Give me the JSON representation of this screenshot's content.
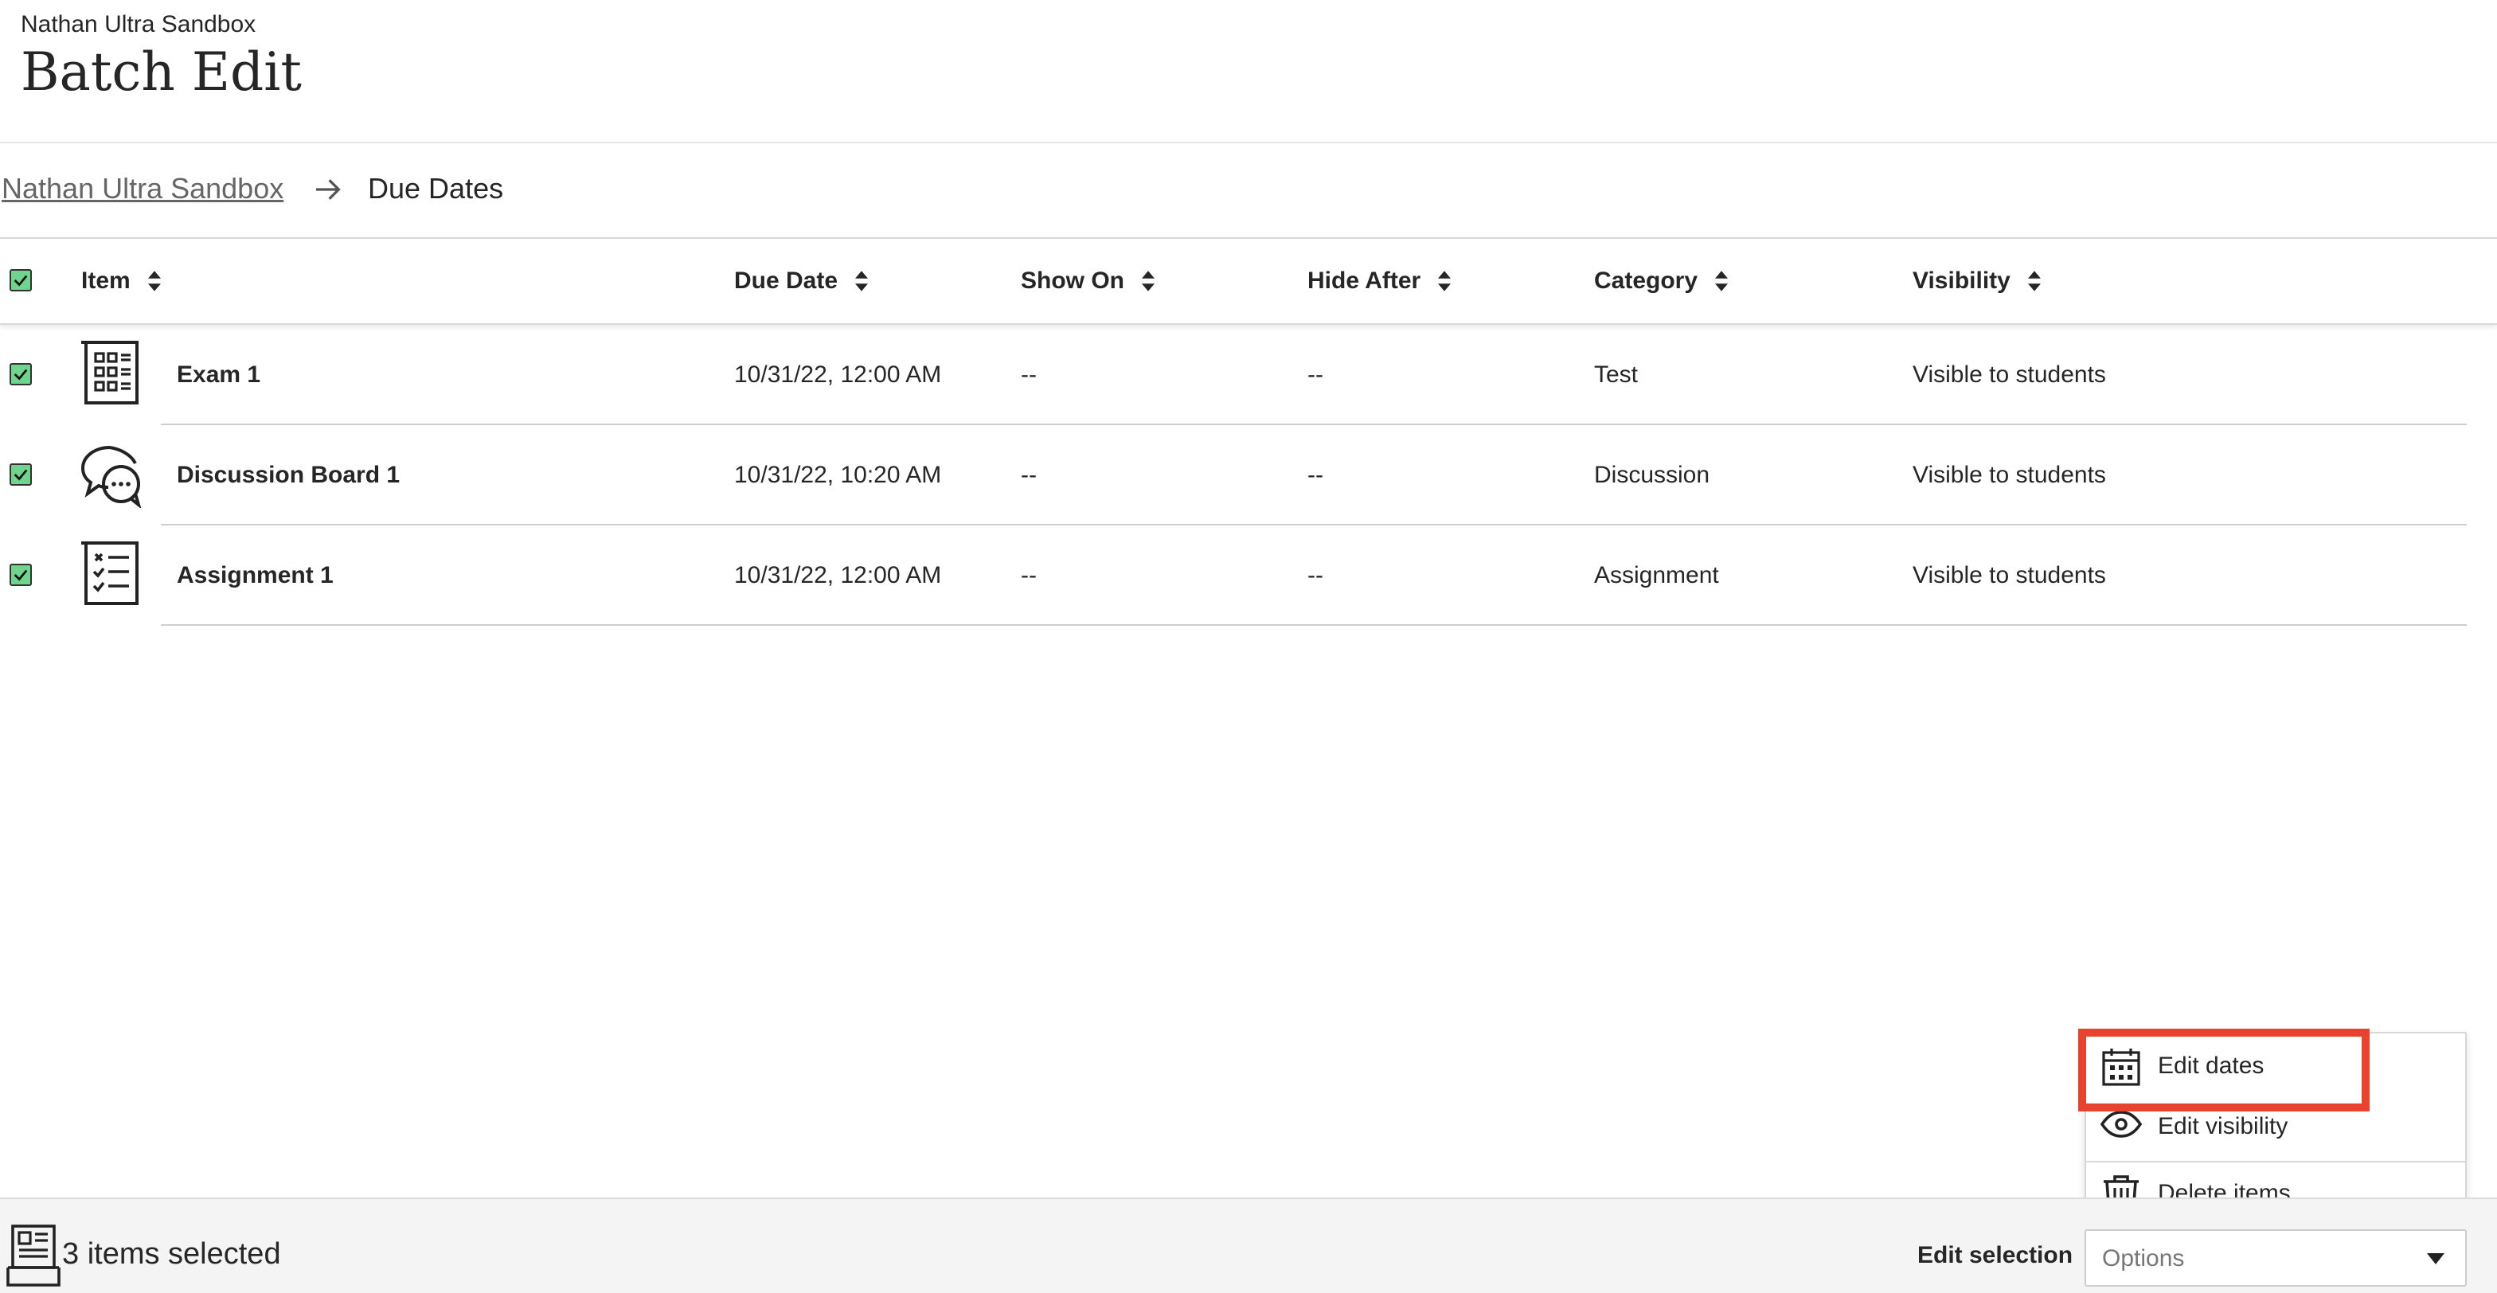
{
  "header": {
    "course_name": "Nathan Ultra Sandbox",
    "title": "Batch Edit"
  },
  "breadcrumb": {
    "parent": "Nathan Ultra Sandbox",
    "current": "Due Dates"
  },
  "table": {
    "columns": [
      "Item",
      "Due Date",
      "Show On",
      "Hide After",
      "Category",
      "Visibility"
    ],
    "rows": [
      {
        "icon": "test-icon",
        "name": "Exam 1",
        "due_date": "10/31/22, 12:00 AM",
        "show_on": "--",
        "hide_after": "--",
        "category": "Test",
        "visibility": "Visible to students",
        "checked": true
      },
      {
        "icon": "discussion-icon",
        "name": "Discussion Board 1",
        "due_date": "10/31/22, 10:20 AM",
        "show_on": "--",
        "hide_after": "--",
        "category": "Discussion",
        "visibility": "Visible to students",
        "checked": true
      },
      {
        "icon": "assignment-icon",
        "name": "Assignment 1",
        "due_date": "10/31/22, 12:00 AM",
        "show_on": "--",
        "hide_after": "--",
        "category": "Assignment",
        "visibility": "Visible to students",
        "checked": true
      }
    ]
  },
  "footer": {
    "selection_count": "3 items selected",
    "edit_selection_label": "Edit selection",
    "options_placeholder": "Options"
  },
  "menu": {
    "items": [
      {
        "label": "Edit dates",
        "icon": "calendar-icon"
      },
      {
        "label": "Edit visibility",
        "icon": "eye-icon"
      },
      {
        "label": "Delete items",
        "icon": "trash-icon"
      }
    ]
  },
  "colors": {
    "checkbox": "#6fd48e",
    "highlight": "#e8432f",
    "footer_bg": "#f4f4f4"
  }
}
